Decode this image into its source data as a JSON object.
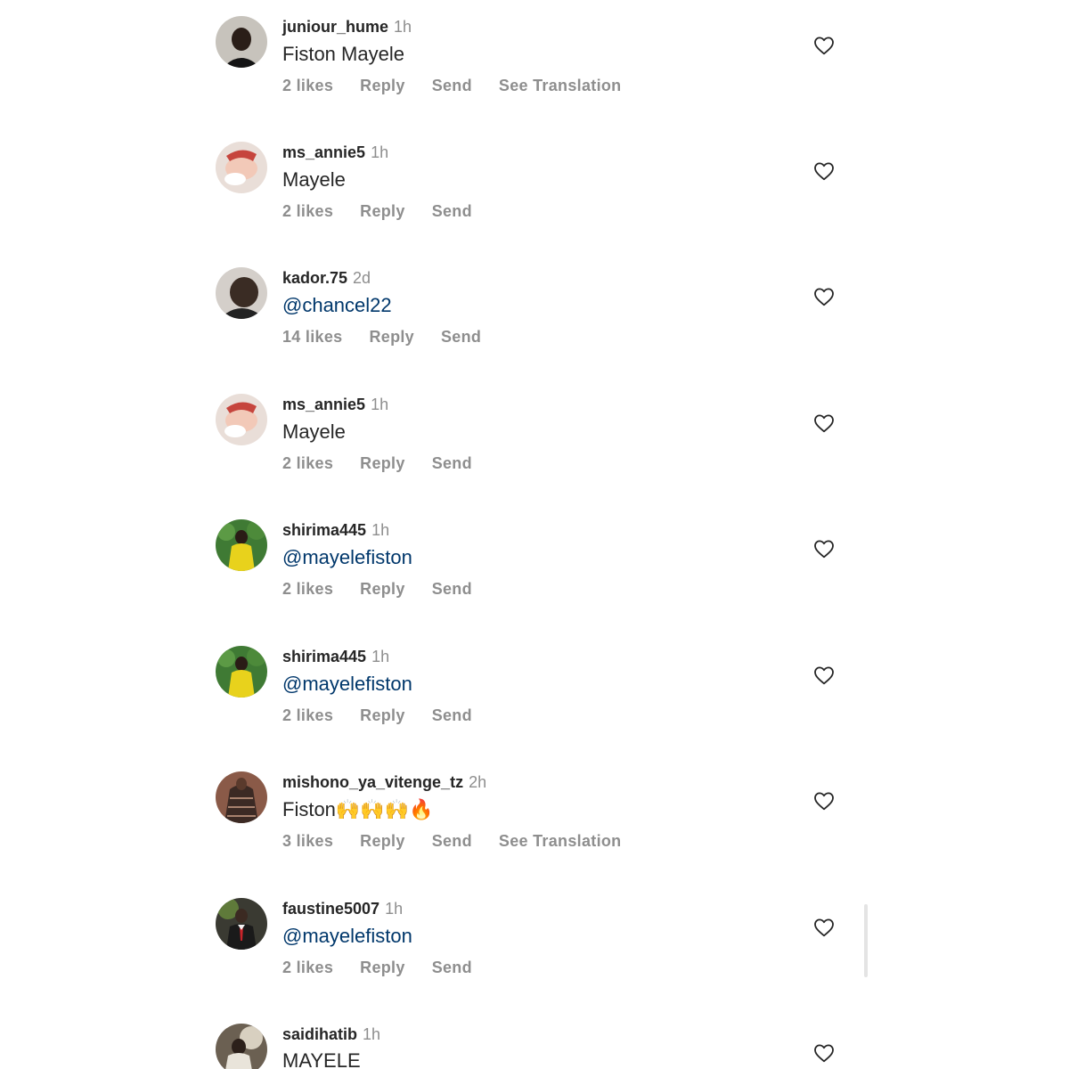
{
  "comments": [
    {
      "username": "juniour_hume",
      "time": "1h",
      "text": "Fiston Mayele",
      "is_mention": false,
      "likes": "2 likes",
      "reply": "Reply",
      "send": "Send",
      "translation": "See Translation"
    },
    {
      "username": "ms_annie5",
      "time": "1h",
      "text": "Mayele",
      "is_mention": false,
      "likes": "2 likes",
      "reply": "Reply",
      "send": "Send",
      "translation": ""
    },
    {
      "username": "kador.75",
      "time": "2d",
      "text": "@chancel22",
      "is_mention": true,
      "likes": "14 likes",
      "reply": "Reply",
      "send": "Send",
      "translation": ""
    },
    {
      "username": "ms_annie5",
      "time": "1h",
      "text": "Mayele",
      "is_mention": false,
      "likes": "2 likes",
      "reply": "Reply",
      "send": "Send",
      "translation": ""
    },
    {
      "username": "shirima445",
      "time": "1h",
      "text": "@mayelefiston",
      "is_mention": true,
      "likes": "2 likes",
      "reply": "Reply",
      "send": "Send",
      "translation": ""
    },
    {
      "username": "shirima445",
      "time": "1h",
      "text": "@mayelefiston",
      "is_mention": true,
      "likes": "2 likes",
      "reply": "Reply",
      "send": "Send",
      "translation": ""
    },
    {
      "username": "mishono_ya_vitenge_tz",
      "time": "2h",
      "text": "Fiston🙌🙌🙌🔥",
      "is_mention": false,
      "likes": "3 likes",
      "reply": "Reply",
      "send": "Send",
      "translation": "See Translation"
    },
    {
      "username": "faustine5007",
      "time": "1h",
      "text": "@mayelefiston",
      "is_mention": true,
      "likes": "2 likes",
      "reply": "Reply",
      "send": "Send",
      "translation": ""
    },
    {
      "username": "saidihatib",
      "time": "1h",
      "text": "MAYELE",
      "is_mention": false,
      "likes": "",
      "reply": "",
      "send": "",
      "translation": ""
    }
  ],
  "icons": {
    "like": "heart-outline-icon"
  },
  "colors": {
    "username": "#262626",
    "meta": "#8e8e8e",
    "mention": "#00376b"
  }
}
